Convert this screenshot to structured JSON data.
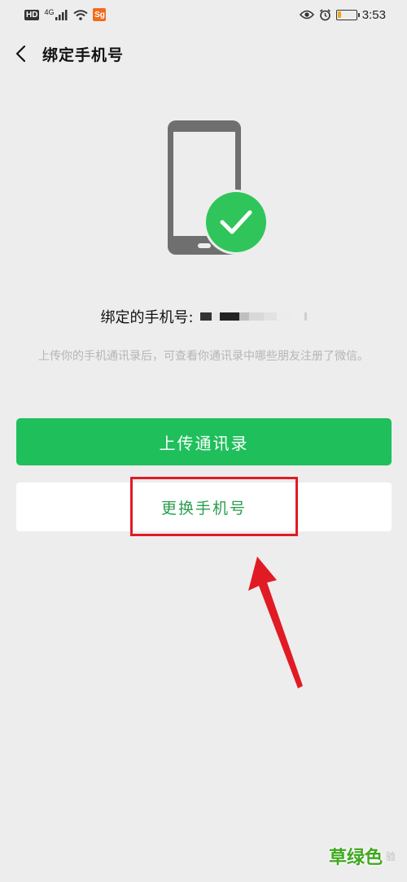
{
  "status_bar": {
    "hd": "HD",
    "network": "4G",
    "app_badge": "Sg",
    "time": "3:53",
    "battery_level": 0.2
  },
  "nav": {
    "back_icon": "chevron-left-icon",
    "title": "绑定手机号"
  },
  "illustration": {
    "phone_icon": "phone-icon",
    "check_icon": "check-icon",
    "check_color": "#2fc55a"
  },
  "bound": {
    "label": "绑定的手机号:"
  },
  "description": "上传你的手机通讯录后，可查看你通讯录中哪些朋友注册了微信。",
  "buttons": {
    "upload_label": "上传通讯录",
    "change_label": "更换手机号"
  },
  "colors": {
    "primary_green": "#1fbf5c",
    "link_green": "#2a9d4e",
    "annotation_red": "#e01b24"
  },
  "watermark": {
    "text": "草绿色",
    "sub": "验"
  }
}
